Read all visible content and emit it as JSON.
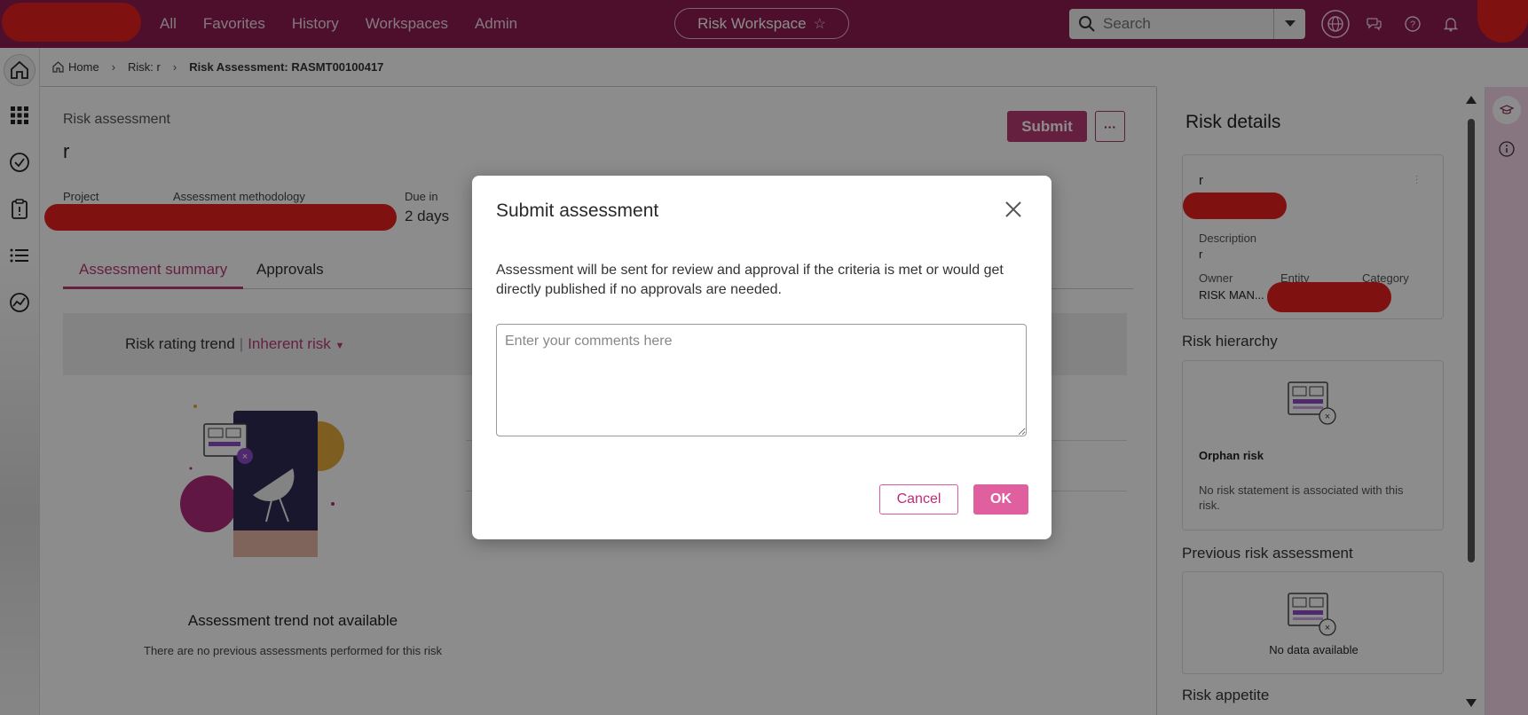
{
  "nav": {
    "links": [
      "All",
      "Favorites",
      "History",
      "Workspaces",
      "Admin"
    ],
    "workspace_label": "Risk Workspace",
    "search_placeholder": "Search"
  },
  "breadcrumb": {
    "home": "Home",
    "risk": "Risk: r",
    "current": "Risk Assessment: RASMT00100417"
  },
  "main": {
    "label": "Risk assessment",
    "title": "r",
    "submit_label": "Submit",
    "more_label": "···",
    "meta": {
      "project_label": "Project",
      "methodology_label": "Assessment methodology",
      "due_label": "Due in",
      "due_value": "2 days"
    },
    "tabs": [
      "Assessment summary",
      "Approvals"
    ],
    "trend": {
      "label": "Risk rating trend",
      "separator": "|",
      "selected": "Inherent risk"
    },
    "empty_title": "Assessment trend not available",
    "empty_sub": "There are no previous assessments performed for this risk"
  },
  "right_panel": {
    "title": "Risk details",
    "card": {
      "name": "r",
      "description_label": "Description",
      "description_value": "r",
      "owner_label": "Owner",
      "owner_value": "RISK MAN...",
      "entity_label": "Entity",
      "category_label": "Category"
    },
    "hierarchy": {
      "title": "Risk hierarchy",
      "card_title": "Orphan risk",
      "card_text": "No risk statement is associated with this risk."
    },
    "previous": {
      "title": "Previous risk assessment",
      "text": "No data available"
    },
    "appetite_title": "Risk appetite"
  },
  "dialog": {
    "title": "Submit assessment",
    "message": "Assessment will be sent for review and approval if the criteria is met or would get directly published if no approvals are needed.",
    "placeholder": "Enter your comments here",
    "cancel_label": "Cancel",
    "ok_label": "OK"
  },
  "colors": {
    "brand": "#8c1c4f",
    "accent": "#b93b76",
    "ok_button": "#e0609f"
  }
}
